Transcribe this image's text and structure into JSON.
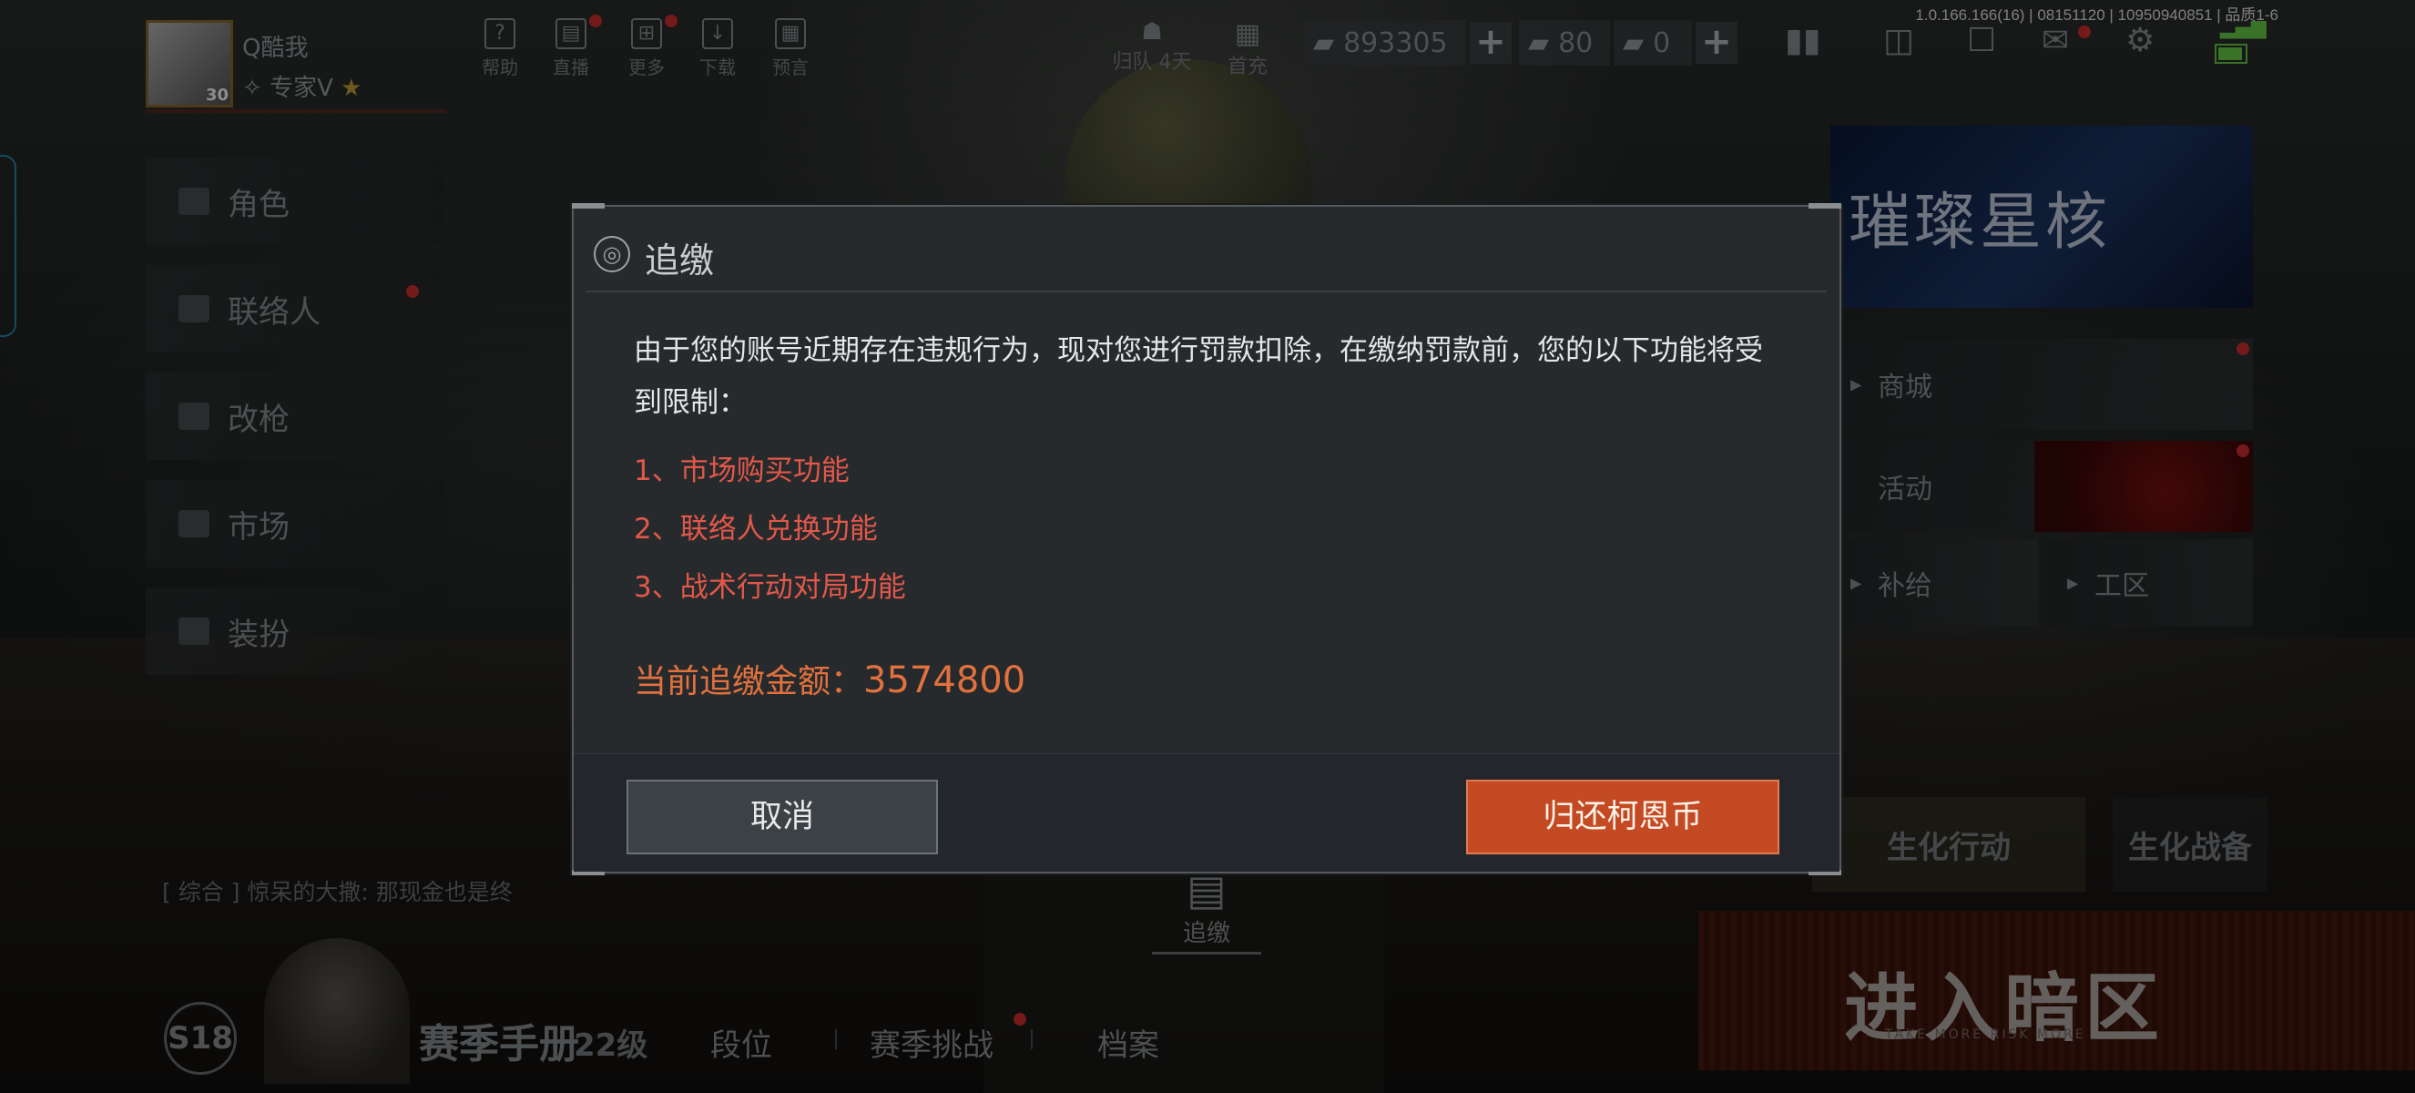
{
  "status_bar": {
    "version": "1.0.166.166(16) | 08151120 | 10950940851 | 品质1-6"
  },
  "player": {
    "name": "Q酷我",
    "rank": "专家V",
    "level": "30"
  },
  "top_nav": [
    {
      "label": "帮助",
      "icon": "help-icon"
    },
    {
      "label": "直播",
      "icon": "live-icon"
    },
    {
      "label": "更多",
      "icon": "more-icon"
    },
    {
      "label": "下载",
      "icon": "download-icon"
    },
    {
      "label": "预言",
      "icon": "calendar-icon"
    }
  ],
  "squad": {
    "label": "归队 4天"
  },
  "first_charge": {
    "label": "首充"
  },
  "currencies": {
    "coins": "893305",
    "tickets": "80",
    "vouchers": "0"
  },
  "left_menu": [
    "角色",
    "联络人",
    "改枪",
    "市场",
    "装扮"
  ],
  "right_panel": {
    "banner_title": "璀璨星核",
    "shop": "商城",
    "activity": "活动",
    "supply": "补给",
    "work_area": "工区",
    "bio_action": "生化行动",
    "bio_battle": "生化战备",
    "enter_dark": "进入暗区",
    "enter_dark_sub": "TAKE MORE RISK MORE"
  },
  "chat": {
    "text": "[ 综合 ] 惊呆的大撒: 那现金也是终"
  },
  "recall_chip": {
    "label": "追缴"
  },
  "bottom_bar": {
    "season": "S18",
    "season_title": "赛季手册",
    "season_level": "22级",
    "rank": "段位",
    "challenge": "赛季挑战",
    "archive": "档案"
  },
  "modal": {
    "title": "追缴",
    "body": "由于您的账号近期存在违规行为，现对您进行罚款扣除，在缴纳罚款前，您的以下功能将受到限制：",
    "restrictions": [
      "1、市场购买功能",
      "2、联络人兑换功能",
      "3、战术行动对局功能"
    ],
    "amount_label": "当前追缴金额：",
    "amount_value": "3574800",
    "cancel": "取消",
    "confirm": "归还柯恩币"
  }
}
